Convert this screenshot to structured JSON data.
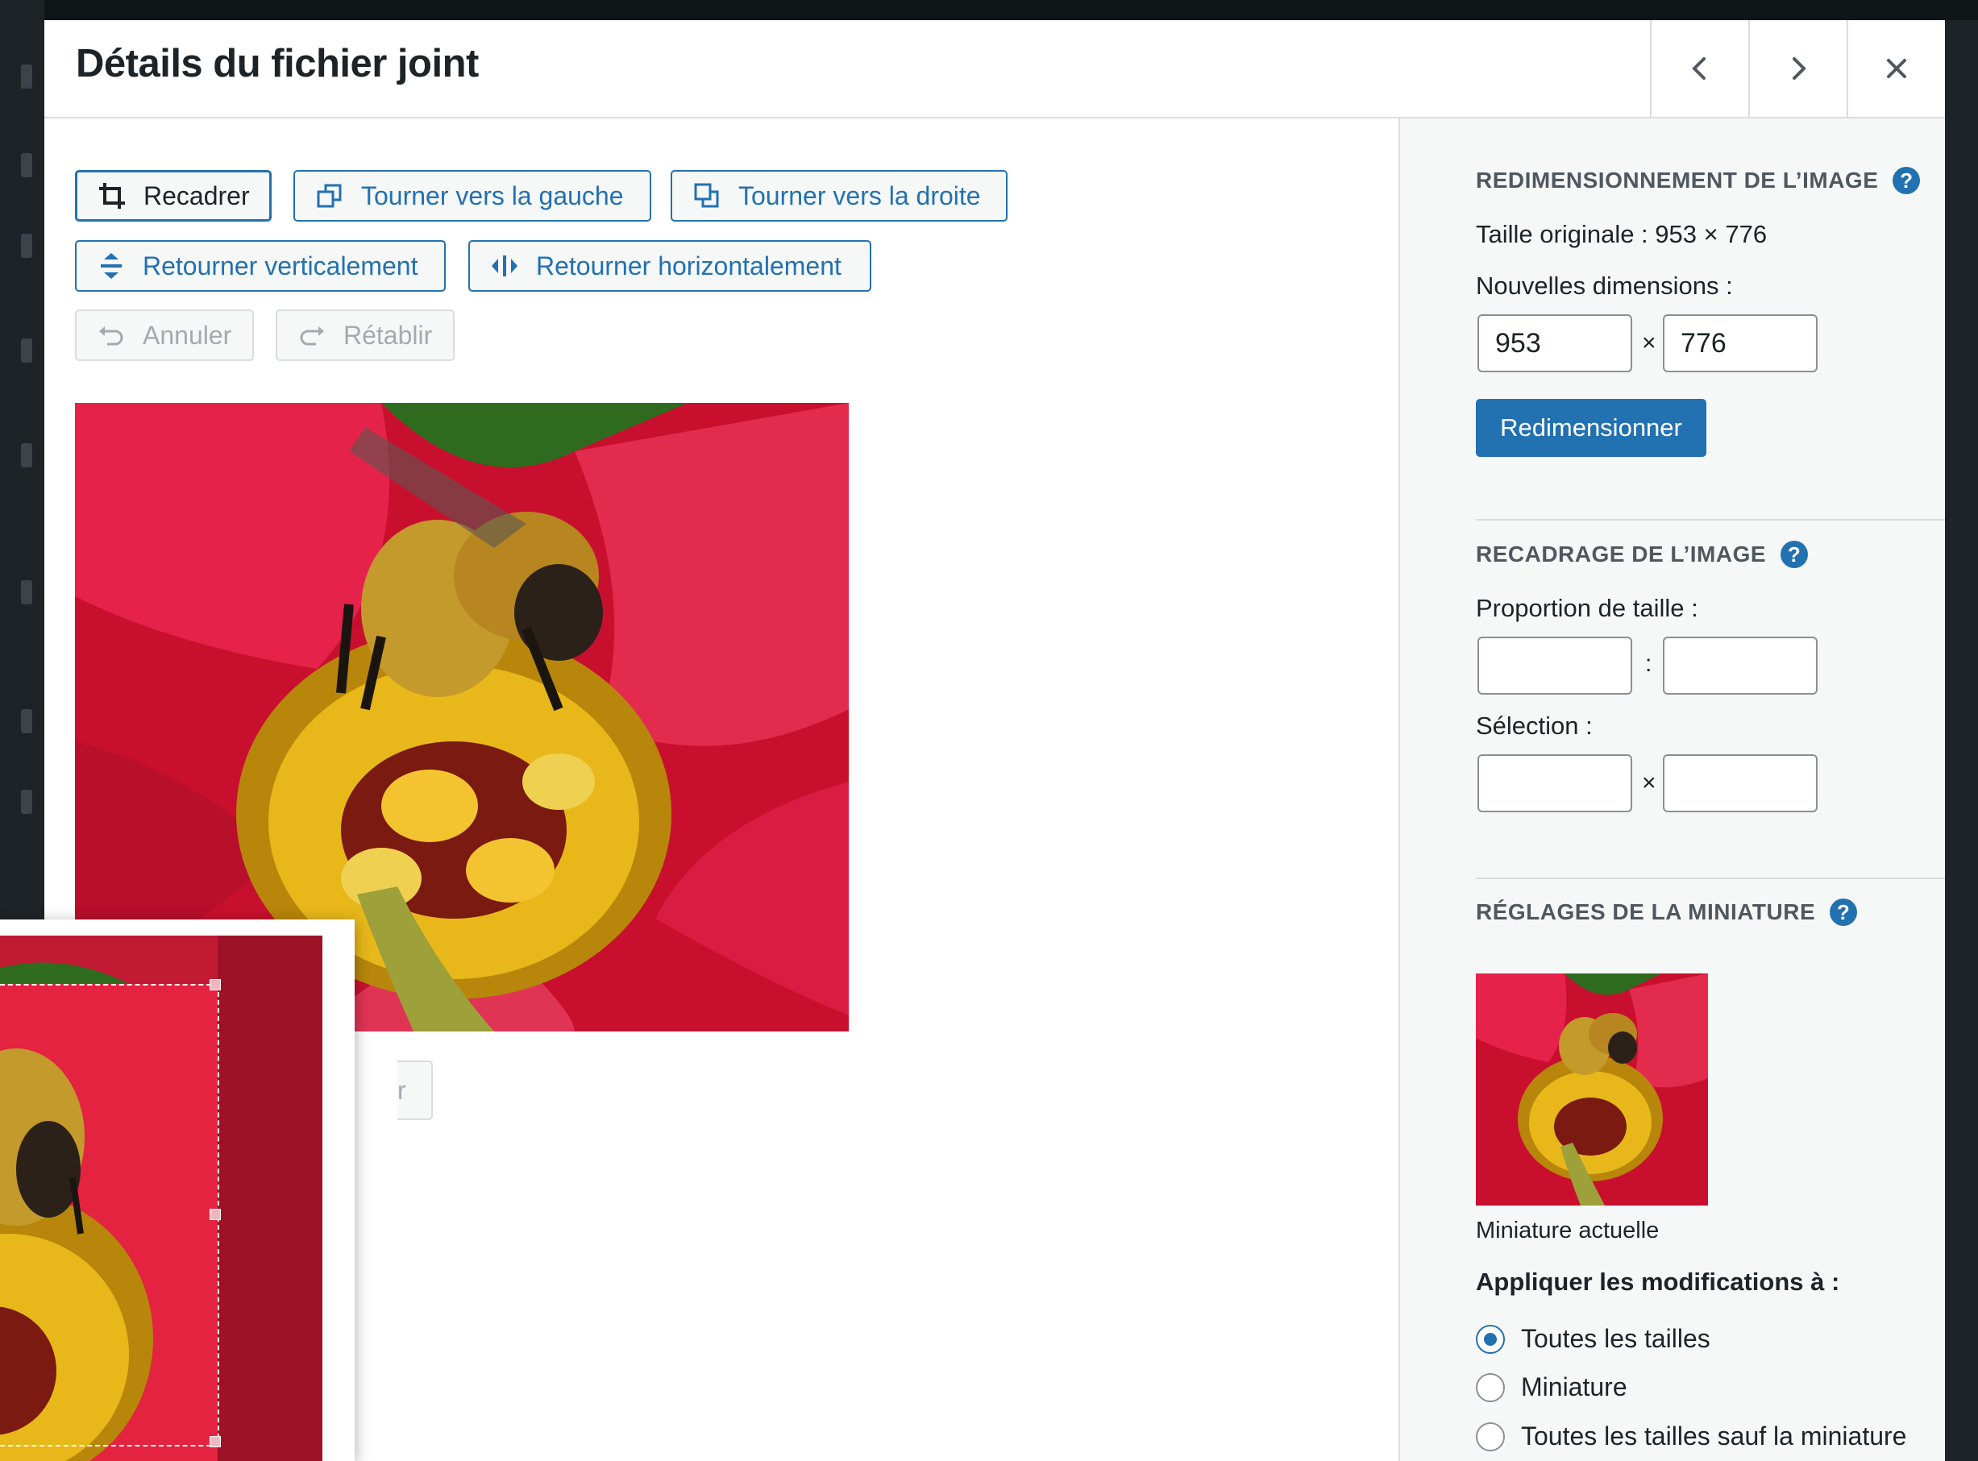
{
  "modal": {
    "title": "Détails du fichier joint",
    "prev_icon": "chevron-left-icon",
    "next_icon": "chevron-right-icon",
    "close_icon": "close-icon"
  },
  "toolbar": {
    "crop": "Recadrer",
    "rotate_left": "Tourner vers la gauche",
    "rotate_right": "Tourner vers la droite",
    "flip_vertical": "Retourner verticalement",
    "flip_horizontal": "Retourner horizontalement",
    "undo": "Annuler",
    "redo": "Rétablir"
  },
  "crop_preview": {
    "partial_button_text": "r"
  },
  "sidebar": {
    "resize": {
      "title": "REDIMENSIONNEMENT DE L’IMAGE",
      "original_size": "Taille originale : 953 × 776",
      "new_dimensions_label": "Nouvelles dimensions :",
      "width_value": "953",
      "height_value": "776",
      "separator": "×",
      "button": "Redimensionner"
    },
    "crop": {
      "title": "RECADRAGE DE L’IMAGE",
      "ratio_label": "Proportion de taille :",
      "ratio_separator": ":",
      "ratio_w": "",
      "ratio_h": "",
      "selection_label": "Sélection :",
      "selection_separator": "×",
      "selection_w": "",
      "selection_h": ""
    },
    "thumbnail": {
      "title": "RÉGLAGES DE LA MINIATURE",
      "caption": "Miniature actuelle",
      "apply_label": "Appliquer les modifications à :",
      "options": [
        {
          "label": "Toutes les tailles",
          "checked": true
        },
        {
          "label": "Miniature",
          "checked": false
        },
        {
          "label": "Toutes les tailles sauf la miniature",
          "checked": false
        }
      ]
    },
    "help_icon_glyph": "?"
  },
  "colors": {
    "accent": "#2271b1",
    "flower_red": "#d81e3c",
    "pollen_yellow": "#e8b81a"
  }
}
